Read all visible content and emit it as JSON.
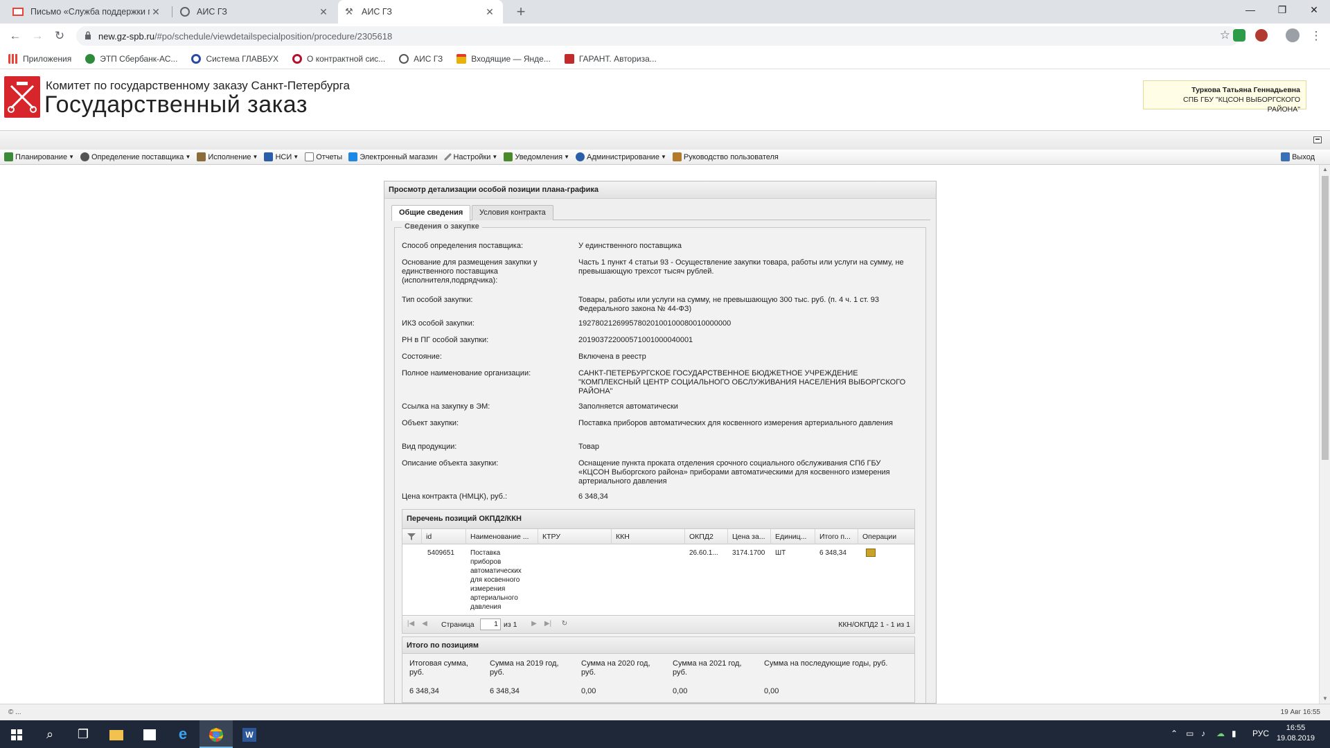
{
  "browser": {
    "tabs": [
      {
        "title": "Письмо «Служба поддержки пол",
        "icon": "gmail-icon",
        "active": false
      },
      {
        "title": "АИС ГЗ",
        "icon": "globe-icon",
        "active": false
      },
      {
        "title": "АИС ГЗ",
        "icon": "tools-icon",
        "active": true
      }
    ],
    "url_host": "new.gz-spb.ru",
    "url_path": "/#po/schedule/viewdetailspecialposition/procedure/2305618",
    "bookmarks": [
      {
        "label": "Приложения",
        "color": "#4285f4"
      },
      {
        "label": "ЭТП Сбербанк-АС...",
        "color": "#2e8b3a"
      },
      {
        "label": "Система ГЛАВБУХ",
        "color": "#2b4aa8"
      },
      {
        "label": "О контрактной сис...",
        "color": "#b3122e"
      },
      {
        "label": "АИС ГЗ",
        "color": "#555555"
      },
      {
        "label": "Входящие — Яндe...",
        "color": "#e8b10b"
      },
      {
        "label": "ГАРАНТ. Авториза...",
        "color": "#c22b2b"
      }
    ]
  },
  "site": {
    "org_name": "Комитет по государственному заказу Санкт-Петербурга",
    "title": "Государственный заказ",
    "user_name": "Туркова Татьяна Геннадьевна",
    "user_org": "СПБ ГБУ \"КЦСОН ВЫБОРГСКОГО РАЙОНА\""
  },
  "menu": {
    "items": [
      {
        "label": "Планирование",
        "dropdown": true,
        "color": "#3a8a3a"
      },
      {
        "label": "Определение поставщика",
        "dropdown": true,
        "color": "#555555"
      },
      {
        "label": "Исполнение",
        "dropdown": true,
        "color": "#8a6d3b"
      },
      {
        "label": "НСИ",
        "dropdown": true,
        "color": "#2b5ea8"
      },
      {
        "label": "Отчеты",
        "dropdown": false,
        "color": "#777777"
      },
      {
        "label": "Электронный магазин",
        "dropdown": false,
        "color": "#1e88e5"
      },
      {
        "label": "Настройки",
        "dropdown": true,
        "color": "#666666"
      },
      {
        "label": "Уведомления",
        "dropdown": true,
        "color": "#4a8a2a"
      },
      {
        "label": "Администрирование",
        "dropdown": true,
        "color": "#2b5ea8"
      },
      {
        "label": "Руководство пользователя",
        "dropdown": false,
        "color": "#b07a2a"
      }
    ],
    "logout": "Выход"
  },
  "panel": {
    "title": "Просмотр детализации особой позиции плана-графика",
    "tabs": [
      "Общие сведения",
      "Условия контракта"
    ],
    "section_title": "Сведения о закупке",
    "fields": [
      {
        "label": "Способ определения поставщика:",
        "value": "У единственного поставщика"
      },
      {
        "label": "Основание для размещения закупки у единственного поставщика (исполнителя,подрядчика):",
        "value": "Часть 1 пункт 4 статьи 93 - Осуществление закупки товара, работы или услуги на сумму, не превышающую трехсот тысяч рублей."
      },
      {
        "label": "Тип особой закупки:",
        "value": "Товары, работы или услуги на сумму, не превышающую 300 тыс. руб. (п. 4 ч. 1 ст. 93 Федерального закона № 44-ФЗ)"
      },
      {
        "label": "ИКЗ особой закупки:",
        "value": "192780212699578020100100080010000000"
      },
      {
        "label": "РН в ПГ особой закупки:",
        "value": "201903722000571001000040001"
      },
      {
        "label": "Состояние:",
        "value": "Включена в реестр"
      },
      {
        "label": "Полное наименование организации:",
        "value": "САНКТ-ПЕТЕРБУРГСКОЕ ГОСУДАРСТВЕННОЕ БЮДЖЕТНОЕ УЧРЕЖДЕНИЕ \"КОМПЛЕКСНЫЙ ЦЕНТР СОЦИАЛЬНОГО ОБСЛУЖИВАНИЯ НАСЕЛЕНИЯ ВЫБОРГСКОГО РАЙОНА\""
      },
      {
        "label": "Ссылка на закупку в ЭМ:",
        "value": "Заполняется автоматически"
      },
      {
        "label": "Объект закупки:",
        "value": "Поставка приборов автоматических для косвенного измерения артериального давления"
      },
      {
        "label": "Вид продукции:",
        "value": "Товар"
      },
      {
        "label": "Описание объекта закупки:",
        "value": "Оснащение пункта проката отделения срочного социального обслуживания СПб ГБУ «КЦСОН Выборгского района» приборами автоматическими для косвенного измерения артериального давления"
      },
      {
        "label": "Цена контракта (НМЦК), руб.:",
        "value": "6 348,34"
      }
    ],
    "grid": {
      "title": "Перечень позиций ОКПД2/ККН",
      "columns": [
        "id",
        "Наименование ...",
        "КТРУ",
        "ККН",
        "ОКПД2",
        "Цена за...",
        "Единиц...",
        "Итого п...",
        "Операции"
      ],
      "row": {
        "id": "5409651",
        "name": "Поставка приборов автоматических для косвенного измерения артериального давления",
        "ktru": "",
        "kkn": "",
        "okpd2": "26.60.1...",
        "price": "3174.1700",
        "unit": "ШТ",
        "total": "6 348,34"
      },
      "pager": {
        "page_label": "Страница",
        "page": "1",
        "of": "из 1",
        "info": "ККН/ОКПД2 1 - 1 из 1"
      }
    },
    "totals": {
      "title": "Итого по позициям",
      "columns": [
        {
          "label": "Итоговая сумма, руб.",
          "value": "6 348,34"
        },
        {
          "label": "Сумма на 2019 год, руб.",
          "value": "6 348,34"
        },
        {
          "label": "Сумма на 2020 год, руб.",
          "value": "0,00"
        },
        {
          "label": "Сумма на 2021 год, руб.",
          "value": "0,00"
        },
        {
          "label": "Сумма на последующие годы, руб.",
          "value": "0,00"
        }
      ]
    }
  },
  "status": {
    "left": "© ...",
    "right": "19 Авг 16:55"
  },
  "taskbar": {
    "lang": "РУС",
    "time": "16:55",
    "date": "19.08.2019"
  }
}
